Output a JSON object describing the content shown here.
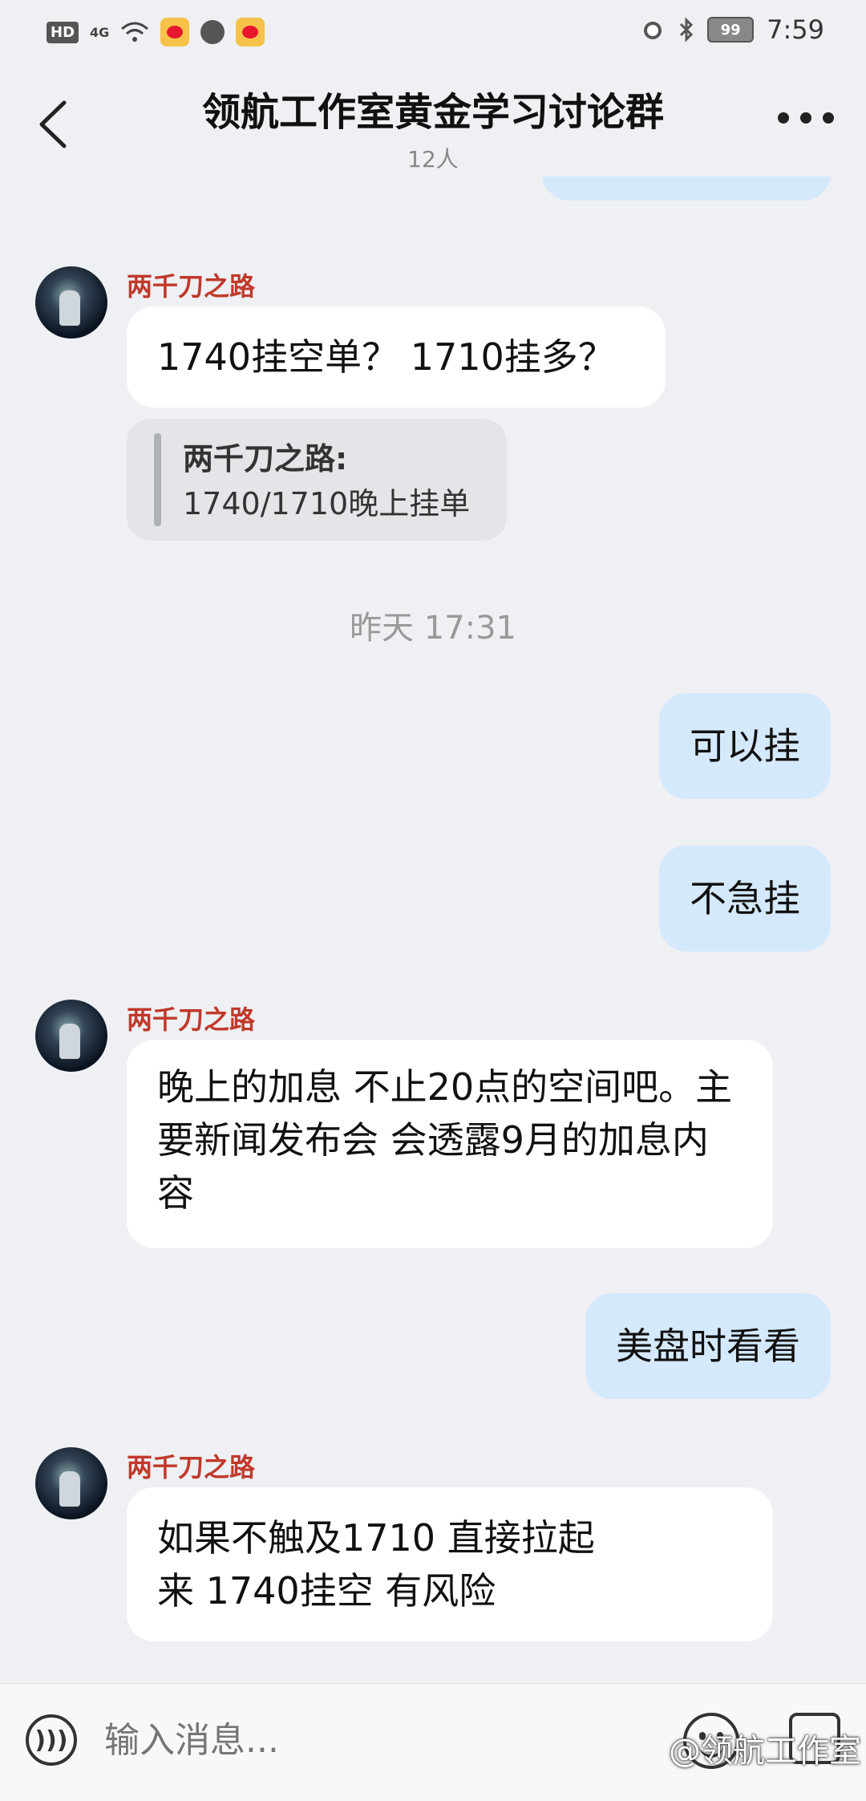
{
  "status_bar": {
    "hd": "HD",
    "network": "4G",
    "battery": "99",
    "time": "7:59"
  },
  "header": {
    "title": "领航工作室黄金学习讨论群",
    "member_count": "12人"
  },
  "messages": [
    {
      "type": "out",
      "text": "",
      "partial": true
    },
    {
      "type": "in",
      "sender": "两千刀之路",
      "text": "1740挂空单？  1710挂多？"
    },
    {
      "type": "quote",
      "quoted_sender": "两千刀之路:",
      "quoted_text": "1740/1710晚上挂单"
    },
    {
      "type": "time",
      "text": "昨天 17:31"
    },
    {
      "type": "out",
      "text": "可以挂"
    },
    {
      "type": "out",
      "text": "不急挂"
    },
    {
      "type": "in",
      "sender": "两千刀之路",
      "text": "晚上的加息 不止20点的空间吧。主要新闻发布会 会透露9月的加息内容"
    },
    {
      "type": "out",
      "text": "美盘时看看"
    },
    {
      "type": "in",
      "sender": "两千刀之路",
      "text": "如果不触及1710 直接拉起来 1740挂空 有风险"
    }
  ],
  "input": {
    "placeholder": "输入消息..."
  },
  "watermark": "@领航工作室",
  "colors": {
    "background": "#eef0f3",
    "incoming_bubble": "#ffffff",
    "outgoing_bubble": "#d5e9fd",
    "sender_name": "#c0392b"
  }
}
